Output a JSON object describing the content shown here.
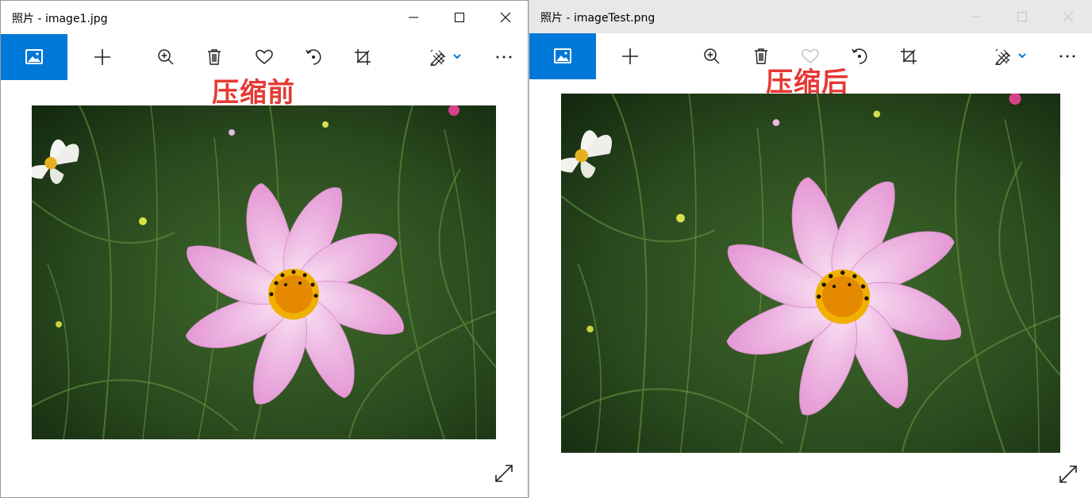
{
  "windows": {
    "left": {
      "title": "照片 - image1.jpg",
      "annotation": "压缩前"
    },
    "right": {
      "title": "照片 - imageTest.png",
      "annotation": "压缩后"
    }
  },
  "colors": {
    "accent": "#0078d7",
    "annotation": "#e53935",
    "inactive_icon": "#c4c4c4"
  },
  "toolbar_icons": [
    "photo-home-icon",
    "add-icon",
    "zoom-in-icon",
    "delete-icon",
    "favorite-icon",
    "rotate-icon",
    "crop-icon",
    "edit-draw-icon",
    "chevron-down-icon",
    "more-icon"
  ],
  "window_controls": [
    "minimize-icon",
    "maximize-icon",
    "close-icon"
  ]
}
